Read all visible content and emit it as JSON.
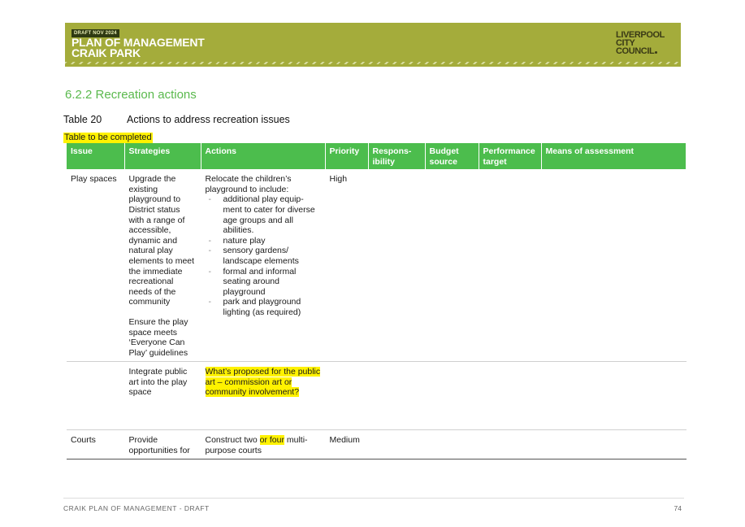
{
  "banner": {
    "draft_tag": "DRAFT NOV 2024",
    "title": "PLAN OF MANAGEMENT",
    "subtitle": "CRAIK PARK",
    "logo_lines": [
      "LIVERPOOL",
      "CITY",
      "COUNCIL"
    ],
    "color": "#a4ac3b"
  },
  "section_heading": "6.2.2 Recreation actions",
  "table_caption": {
    "number": "Table 20",
    "title": "Actions to address recreation issues"
  },
  "table_note": "Table to be completed",
  "table": {
    "header_color": "#4cbd4d",
    "highlight_color": "#fff200",
    "headers": [
      "Issue",
      "Strategies",
      "Actions",
      "Priority",
      "Respons-ibility",
      "Budget source",
      "Performance target",
      "Means of assessment"
    ],
    "rows": [
      {
        "issue": "Play spaces",
        "strategy_1": "Upgrade the existing playground to District status with a range of accessible, dynamic and natural play elements to meet the immediate recreational needs of the community",
        "strategy_2": "Ensure the play space meets ‘Everyone Can Play’ guidelines",
        "action_intro": "Relocate the children’s playground to include:",
        "action_bullets": [
          "additional play equip-ment to cater for diverse age groups and all abilities.",
          "nature play",
          "sensory gardens/ landscape elements",
          "formal and informal seating around playground",
          "park and playground lighting (as required)"
        ],
        "priority": "High"
      },
      {
        "issue": "",
        "strategy": "Integrate public art into the play space",
        "action_highlighted": "What’s proposed for the public art – commission art or community involvement?",
        "priority": ""
      },
      {
        "issue": "Courts",
        "strategy": "Provide opportunities for",
        "action_before": "Construct two ",
        "action_highlighted": "or four",
        "action_after": " multi-purpose courts",
        "priority": "Medium"
      }
    ]
  },
  "footer": {
    "left": "CRAIK PLAN OF MANAGEMENT - DRAFT",
    "page_number": "74"
  }
}
